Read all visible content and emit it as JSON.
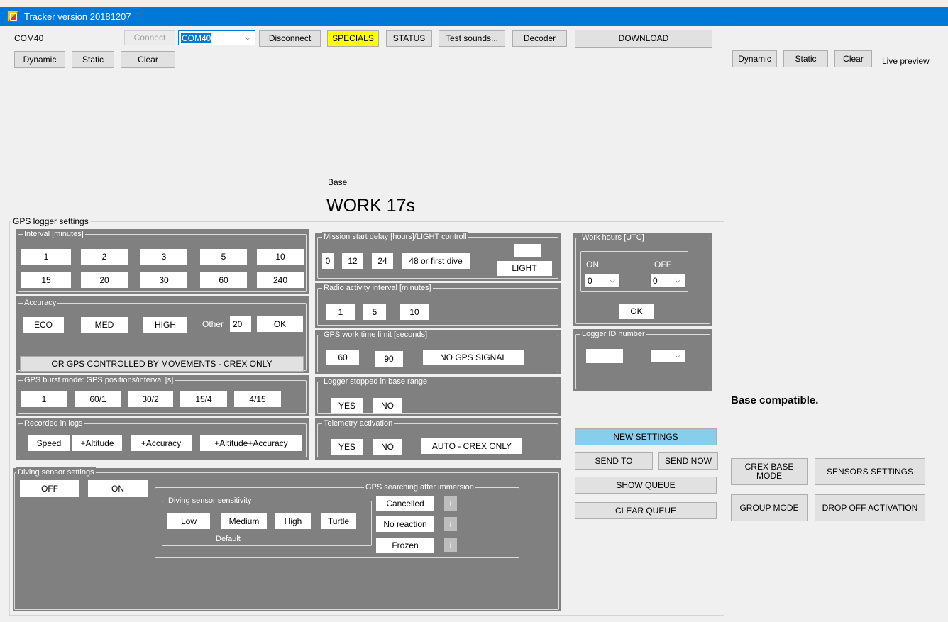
{
  "window": {
    "title": "Tracker version 20181207"
  },
  "top": {
    "com_label": "COM40",
    "connect": "Connect",
    "port_select": "COM40",
    "disconnect": "Disconnect",
    "specials": "SPECIALS",
    "status": "STATUS",
    "test_sounds": "Test sounds...",
    "decoder": "Decoder",
    "download": "DOWNLOAD",
    "dynamic": "Dynamic",
    "static": "Static",
    "clear": "Clear"
  },
  "right_top": {
    "dynamic": "Dynamic",
    "static": "Static",
    "clear": "Clear",
    "live_preview": "Live preview"
  },
  "base": {
    "label": "Base",
    "work": "WORK 17s",
    "compatible": "Base  compatible."
  },
  "gps_logger": {
    "title": "GPS logger settings",
    "interval": {
      "title": "Interval  [minutes]",
      "buttons": [
        "1",
        "2",
        "3",
        "5",
        "10",
        "15",
        "20",
        "30",
        "60",
        "240"
      ]
    },
    "accuracy": {
      "title": "Accuracy",
      "eco": "ECO",
      "med": "MED",
      "high": "HIGH",
      "other_label": "Other",
      "other_value": "20",
      "ok": "OK",
      "movement": "OR GPS CONTROLLED BY MOVEMENTS - CREX ONLY"
    },
    "burst": {
      "title": "GPS burst mode:  GPS positions/interval [s]",
      "buttons": [
        "1",
        "60/1",
        "30/2",
        "15/4",
        "4/15"
      ]
    },
    "recorded": {
      "title": "Recorded in logs",
      "buttons": [
        "Speed",
        "+Altitude",
        "+Accuracy",
        "+Altitude+Accuracy"
      ]
    },
    "mission": {
      "title": "Mission start delay [hours]/LIGHT controll",
      "buttons": [
        "0",
        "12",
        "24",
        "48 or first dive"
      ],
      "light": "LIGHT"
    },
    "radio": {
      "title": "Radio activity interval  [minutes]",
      "buttons": [
        "1",
        "5",
        "10"
      ]
    },
    "gps_work": {
      "title": "GPS work time limit [seconds]",
      "buttons": [
        "60",
        "90",
        "NO GPS SIGNAL"
      ]
    },
    "stopped": {
      "title": "Logger stopped in base range",
      "yes": "YES",
      "no": "NO"
    },
    "telemetry": {
      "title": "Telemetry activation",
      "yes": "YES",
      "no": "NO",
      "auto": "AUTO - CREX ONLY"
    },
    "work_hours": {
      "title": "Work hours [UTC]",
      "on": "ON",
      "off": "OFF",
      "on_value": "0",
      "off_value": "0",
      "ok": "OK"
    },
    "logger_id": {
      "title": "Logger ID number"
    }
  },
  "actions": {
    "new_settings": "NEW SETTINGS",
    "send_to": "SEND TO",
    "send_now": "SEND NOW",
    "show_queue": "SHOW QUEUE",
    "clear_queue": "CLEAR QUEUE"
  },
  "diving": {
    "title": "Diving sensor settings",
    "off": "OFF",
    "on": "ON",
    "gps_search_title": "GPS searching after immersion",
    "sensitivity_title": "Diving sensor sensitivity",
    "sensitivity": [
      "Low",
      "Medium",
      "High",
      "Turtle"
    ],
    "default": "Default",
    "cancelled": "Cancelled",
    "no_reaction": "No reaction",
    "frozen": "Frozen",
    "info": "i"
  },
  "modes": {
    "crex_base": "CREX  BASE MODE",
    "sensors_settings": "SENSORS SETTINGS",
    "group_mode": "GROUP MODE",
    "drop_off": "DROP OFF ACTIVATION"
  },
  "colors": {
    "titlebar": "#0078d7",
    "panel": "#808080",
    "specials": "#ffff00",
    "new_settings": "#87ceeb"
  }
}
